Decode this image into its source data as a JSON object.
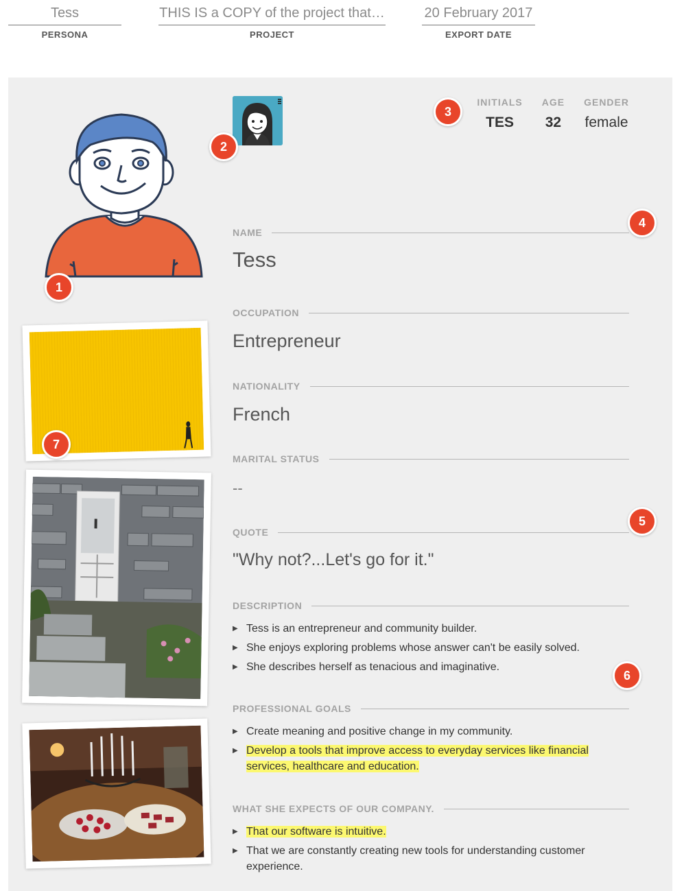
{
  "header": {
    "persona": {
      "value": "Tess",
      "label": "PERSONA"
    },
    "project": {
      "value": "THIS IS a COPY of the project that…",
      "label": "PROJECT"
    },
    "export_date": {
      "value": "20 February 2017",
      "label": "EXPORT DATE"
    }
  },
  "badges": [
    "1",
    "2",
    "3",
    "4",
    "5",
    "6",
    "7"
  ],
  "stats": {
    "initials": {
      "label": "INITIALS",
      "value": "TES"
    },
    "age": {
      "label": "AGE",
      "value": "32"
    },
    "gender": {
      "label": "GENDER",
      "value": "female"
    }
  },
  "sections": {
    "name": {
      "label": "NAME",
      "value": "Tess"
    },
    "occupation": {
      "label": "OCCUPATION",
      "value": "Entrepreneur"
    },
    "nationality": {
      "label": "NATIONALITY",
      "value": "French"
    },
    "marital_status": {
      "label": "MARITAL STATUS",
      "value": "--"
    },
    "quote": {
      "label": "QUOTE",
      "value": "\"Why not?...Let's go for it.\""
    },
    "description": {
      "label": "DESCRIPTION",
      "items": [
        "Tess is an entrepreneur and community builder.",
        "She enjoys exploring problems whose answer can't be easily solved.",
        "She describes herself as tenacious and imaginative."
      ]
    },
    "professional_goals": {
      "label": "PROFESSIONAL GOALS",
      "items": [
        "Create meaning and positive change in my community.",
        "Develop a tools that improve access to everyday services like financial services, healthcare and education."
      ]
    },
    "expectations": {
      "label": "WHAT SHE EXPECTS OF OUR COMPANY.",
      "items": [
        "That our software is intuitive.",
        "That we are constantly creating new tools for understanding customer experience."
      ]
    }
  },
  "colors": {
    "badge": "#e8452a",
    "highlight": "#fcf870",
    "card_bg": "#efefef",
    "shirt": "#e8663d",
    "hair": "#5b86c7"
  },
  "icons": {
    "avatar": "persona-avatar-illustration",
    "small_avatar": "female-avatar-icon",
    "bullet": "triangle-right-icon"
  }
}
